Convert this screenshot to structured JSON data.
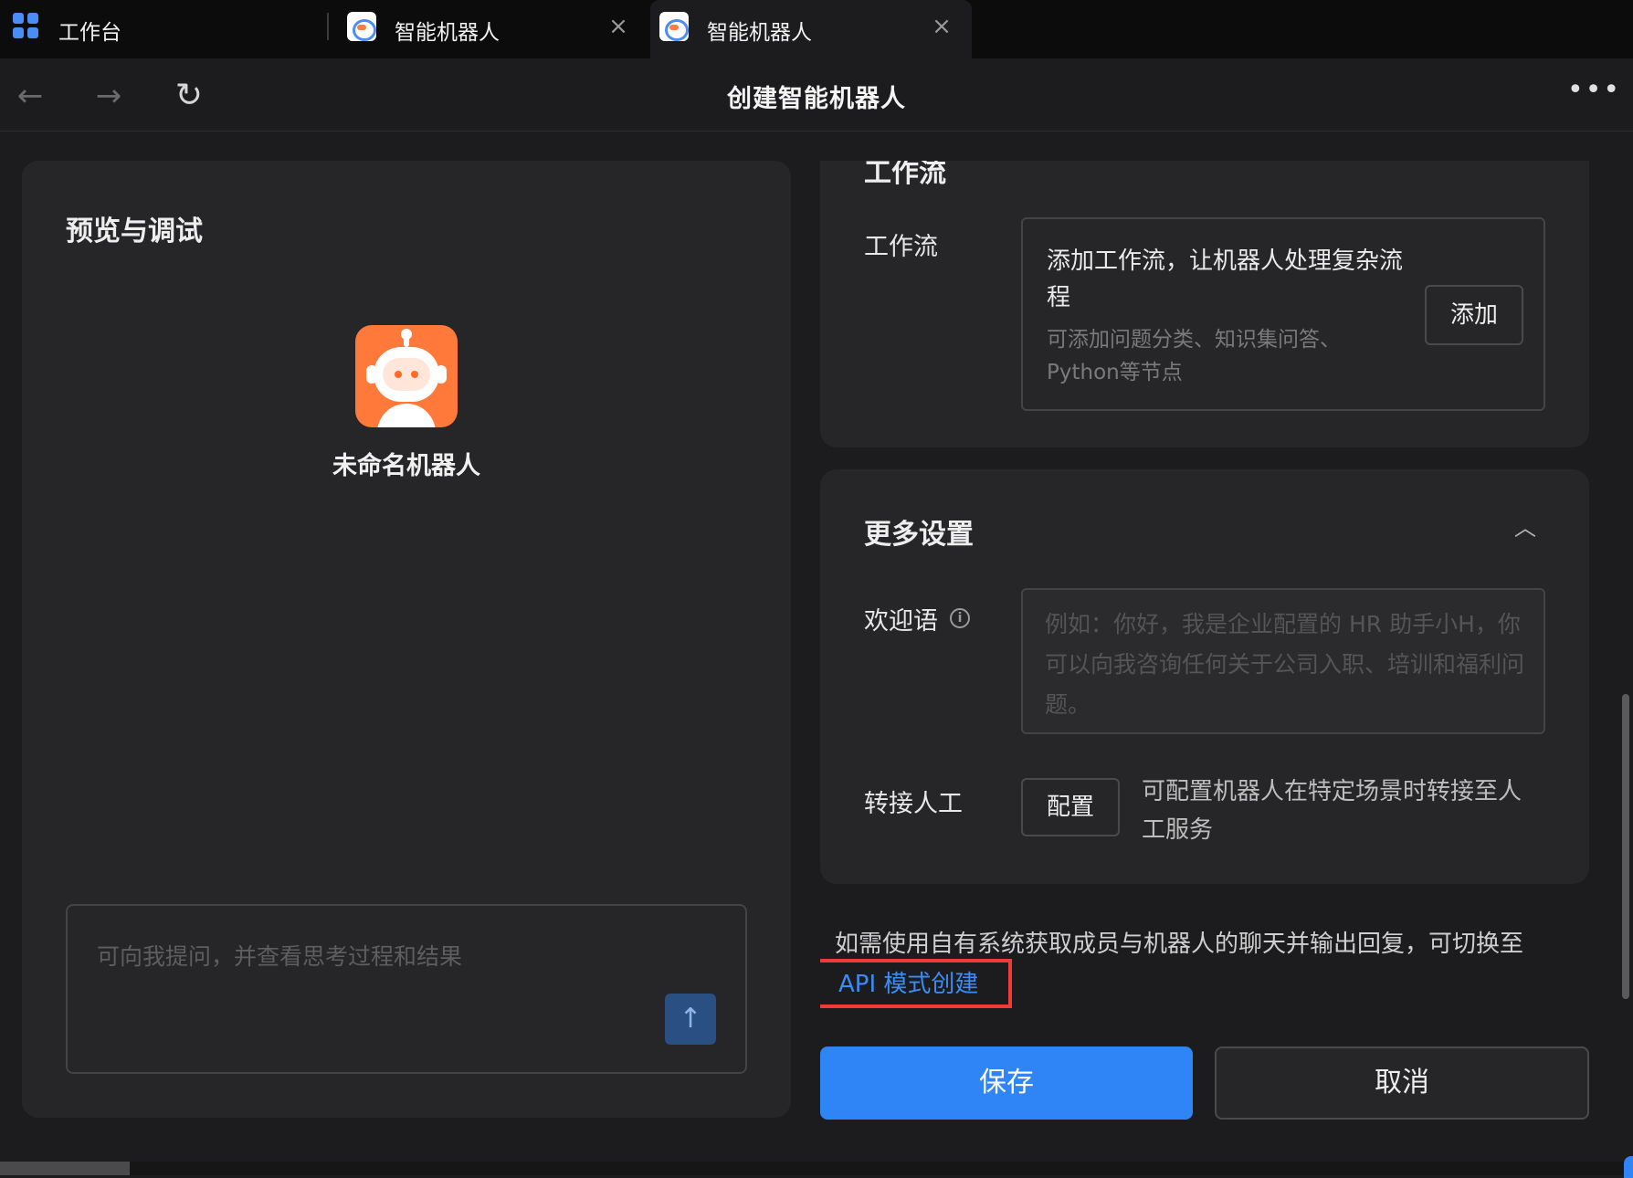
{
  "tabs": [
    {
      "label": "工作台"
    },
    {
      "label": "智能机器人"
    },
    {
      "label": "智能机器人"
    }
  ],
  "nav": {
    "title": "创建智能机器人",
    "back_icon": "arrow-left-icon",
    "forward_icon": "arrow-right-icon",
    "reload_icon": "reload-icon",
    "more_icon": "more-icon"
  },
  "preview": {
    "title": "预览与调试",
    "bot_name": "未命名机器人",
    "chat_placeholder": "可向我提问，并查看思考过程和结果",
    "send_icon": "arrow-up-icon"
  },
  "workflow": {
    "section_title": "工作流",
    "label": "工作流",
    "box_title": "添加工作流，让机器人处理复杂流程",
    "box_desc": "可添加问题分类、知识集问答、Python等节点",
    "add_button": "添加"
  },
  "more_settings": {
    "title": "更多设置",
    "welcome_label": "欢迎语",
    "welcome_placeholder": "例如：你好，我是企业配置的 HR 助手小H，你可以向我咨询任何关于公司入职、培训和福利问题。",
    "transfer_label": "转接人工",
    "config_button": "配置",
    "transfer_desc": "可配置机器人在特定场景时转接至人工服务"
  },
  "api": {
    "note": "如需使用自有系统获取成员与机器人的聊天并输出回复，可切换至",
    "link": "API 模式创建"
  },
  "actions": {
    "save": "保存",
    "cancel": "取消"
  },
  "colors": {
    "accent": "#2f84f6",
    "link": "#3b8cf5",
    "highlight": "#f03a3a",
    "avatar": "#ff7a3a"
  }
}
